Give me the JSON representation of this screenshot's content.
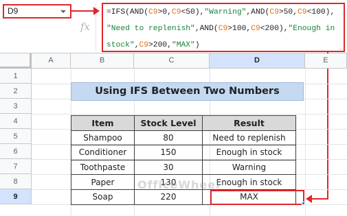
{
  "formula_bar": {
    "name_box": "D9",
    "fx_label": "fx",
    "formula_segments": [
      {
        "t": "=IFS(AND(",
        "k": "p"
      },
      {
        "t": "C9",
        "k": "r"
      },
      {
        "t": ">0,",
        "k": "p"
      },
      {
        "t": "C9",
        "k": "r"
      },
      {
        "t": "<50),",
        "k": "p"
      },
      {
        "t": "\"Warning\"",
        "k": "s"
      },
      {
        "t": ",AND(",
        "k": "p"
      },
      {
        "t": "C9",
        "k": "r"
      },
      {
        "t": ">50,",
        "k": "p"
      },
      {
        "t": "C9",
        "k": "r"
      },
      {
        "t": "<100),",
        "k": "p"
      },
      {
        "t": "\n",
        "k": "p"
      },
      {
        "t": "\"Need to replenish\"",
        "k": "s"
      },
      {
        "t": ",AND(",
        "k": "p"
      },
      {
        "t": "C9",
        "k": "r"
      },
      {
        "t": ">100,",
        "k": "p"
      },
      {
        "t": "C9",
        "k": "r"
      },
      {
        "t": "<200),",
        "k": "p"
      },
      {
        "t": "\"Enough in",
        "k": "s"
      },
      {
        "t": "\n",
        "k": "p"
      },
      {
        "t": "stock\"",
        "k": "s"
      },
      {
        "t": ",",
        "k": "p"
      },
      {
        "t": "C9",
        "k": "r"
      },
      {
        "t": ">200,",
        "k": "p"
      },
      {
        "t": "\"MAX\"",
        "k": "s"
      },
      {
        "t": ")",
        "k": "p"
      }
    ]
  },
  "columns": [
    {
      "label": "",
      "w": 0
    },
    {
      "label": "A"
    },
    {
      "label": "B"
    },
    {
      "label": "C"
    },
    {
      "label": "D"
    },
    {
      "label": "E"
    }
  ],
  "rows": [
    "1",
    "2",
    "3",
    "4",
    "5",
    "6",
    "7",
    "8",
    "9"
  ],
  "title": "Using IFS Between Two Numbers",
  "table": {
    "headers": [
      "Item",
      "Stock Level",
      "Result"
    ],
    "rows": [
      [
        "Shampoo",
        "80",
        "Need to replenish"
      ],
      [
        "Conditioner",
        "150",
        "Enough in stock"
      ],
      [
        "Toothpaste",
        "30",
        "Warning"
      ],
      [
        "Paper",
        "130",
        "Enough in stock"
      ],
      [
        "Soap",
        "220",
        "MAX"
      ]
    ]
  },
  "watermark": "OfficeWheel",
  "accent_color": "#e0262b"
}
